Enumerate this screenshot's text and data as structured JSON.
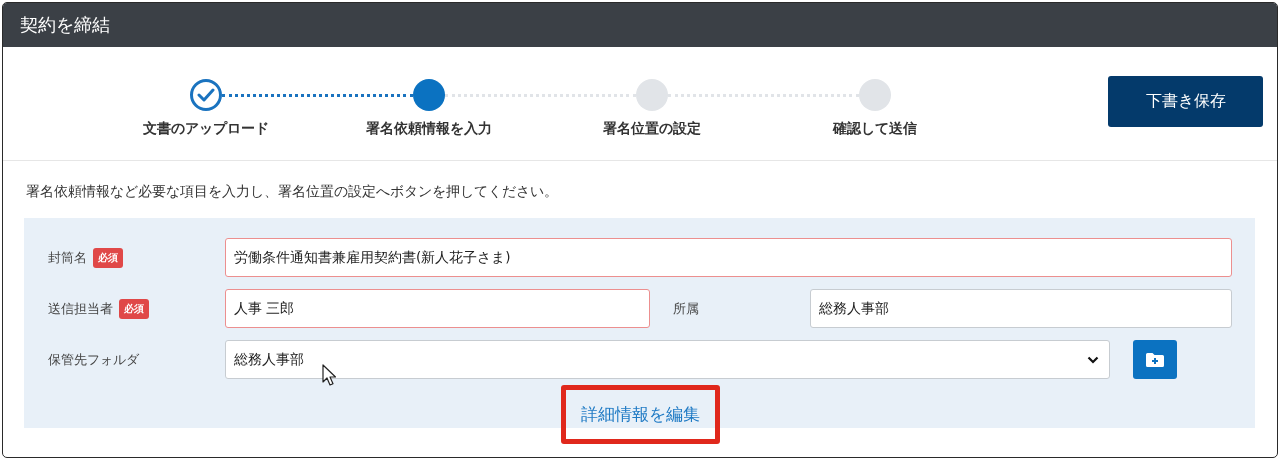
{
  "header": {
    "title": "契約を締結"
  },
  "steps": [
    {
      "label": "文書のアップロード",
      "completed": true,
      "selected": false
    },
    {
      "label": "署名依頼情報を入力",
      "completed": false,
      "selected": true
    },
    {
      "label": "署名位置の設定",
      "completed": false,
      "selected": false
    },
    {
      "label": "確認して送信",
      "completed": false,
      "selected": false
    }
  ],
  "save_button": {
    "label": "下書き保存"
  },
  "instruction": "署名依頼情報など必要な項目を入力し、署名位置の設定へボタンを押してください。",
  "form": {
    "rows": [
      {
        "fields": [
          {
            "kind": "text",
            "label": "封筒名",
            "required": true,
            "badge": "必須",
            "value": "労働条件通知書兼雇用契約書(新人花子さま)"
          }
        ]
      },
      {
        "fields": [
          {
            "kind": "text",
            "label": "送信担当者",
            "required": true,
            "badge": "必須",
            "value": "人事 三郎"
          },
          {
            "kind": "text",
            "label": "所属",
            "required": false,
            "value": "総務人事部"
          }
        ]
      },
      {
        "fields": [
          {
            "kind": "select",
            "label": "保管先フォルダ",
            "required": false,
            "value": "総務人事部"
          }
        ]
      }
    ],
    "detail_link": {
      "label": "詳細情報を編集",
      "highlighted": true
    }
  }
}
